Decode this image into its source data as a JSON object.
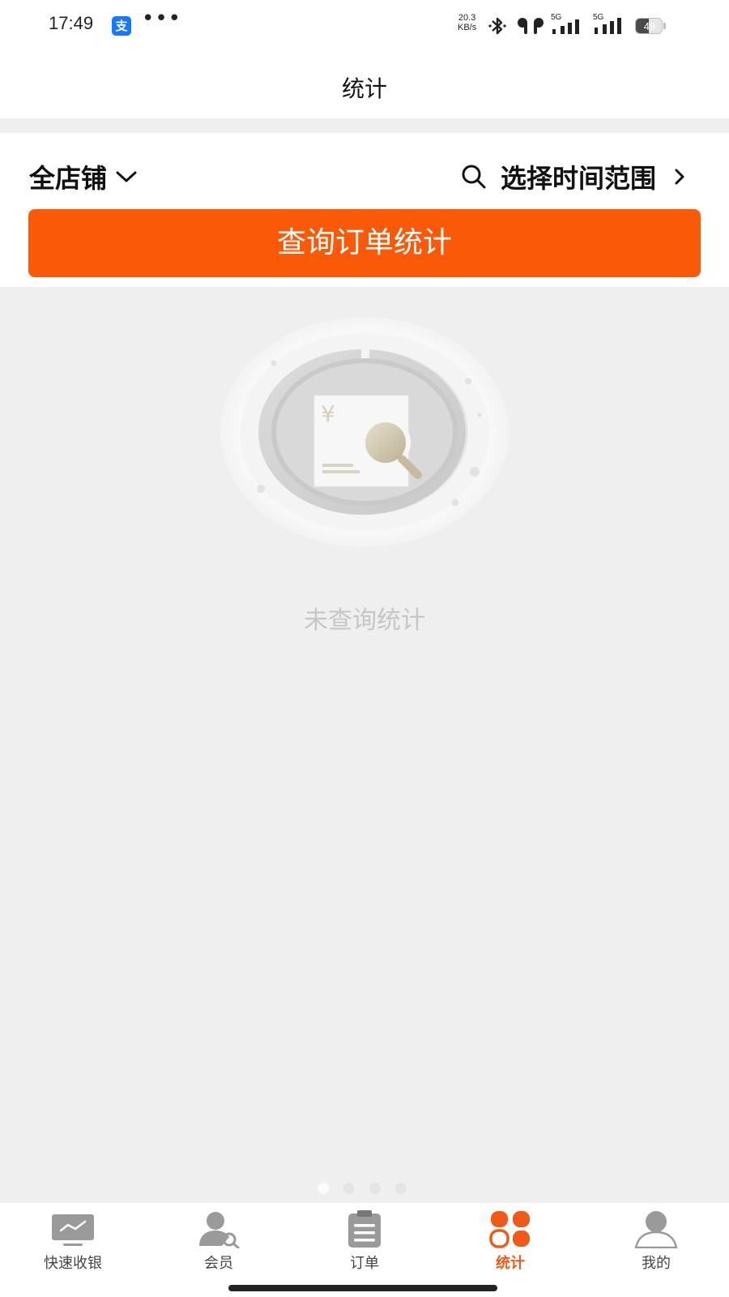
{
  "status_bar": {
    "time": "17:49",
    "alipay_glyph": "支",
    "more": "•••",
    "net_speed_value": "20.3",
    "net_speed_unit": "KB/s",
    "signal1_tech": "5G",
    "signal2_tech": "5G",
    "battery_level": 49,
    "battery_text": "49",
    "icons": [
      "alipay-icon",
      "more-icon",
      "bluetooth-icon",
      "earbuds-icon",
      "signal-icon",
      "signal-icon",
      "battery-icon"
    ]
  },
  "header": {
    "title": "统计"
  },
  "filters": {
    "store_label": "全店铺",
    "time_range_label": "选择时间范围",
    "query_button_label": "查询订单统计"
  },
  "empty_state": {
    "message": "未查询统计",
    "currency_glyph": "¥"
  },
  "pager": {
    "count": 4,
    "active_index": 0
  },
  "bottom_nav": {
    "items": [
      {
        "label": "快速收银",
        "icon": "monitor-icon",
        "active": false
      },
      {
        "label": "会员",
        "icon": "member-icon",
        "active": false
      },
      {
        "label": "订单",
        "icon": "clipboard-icon",
        "active": false
      },
      {
        "label": "统计",
        "icon": "stats-grid-icon",
        "active": true
      },
      {
        "label": "我的",
        "icon": "profile-icon",
        "active": false
      }
    ]
  },
  "colors": {
    "accent": "#fa5a08",
    "accent_nav_active": "#f05a17",
    "background": "#efefef",
    "empty_text": "#c6c6c6",
    "nav_icon": "#9a9a9a"
  }
}
